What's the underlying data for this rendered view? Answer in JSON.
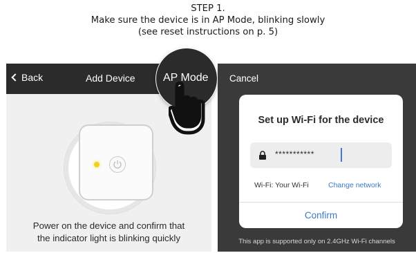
{
  "header": {
    "step": "STEP 1.",
    "line1": "Make sure the device is in AP Mode, blinking slowly",
    "line2": "(see reset instructions on p. 5)"
  },
  "left_screen": {
    "back_label": "Back",
    "title": "Add Device",
    "ap_mode_label": "AP Mode",
    "instruction_line1": "Power on the device and confirm that",
    "instruction_line2": "the indicator light is blinking quickly",
    "icons": [
      "chevron-left-icon",
      "power-icon",
      "pointing-hand-icon"
    ],
    "led_color": "#f1d21a"
  },
  "right_screen": {
    "cancel_label": "Cancel",
    "dialog_title": "Set up Wi-Fi for the device",
    "password_value": "***********",
    "wifi_label": "Wi-Fi: Your Wi-Fi",
    "change_network_label": "Change network",
    "confirm_label": "Confirm",
    "footer_note": "This app is supported only on 2.4GHz Wi-Fi channels",
    "icons": [
      "lock-icon"
    ],
    "accent_color": "#3a7bc8"
  }
}
